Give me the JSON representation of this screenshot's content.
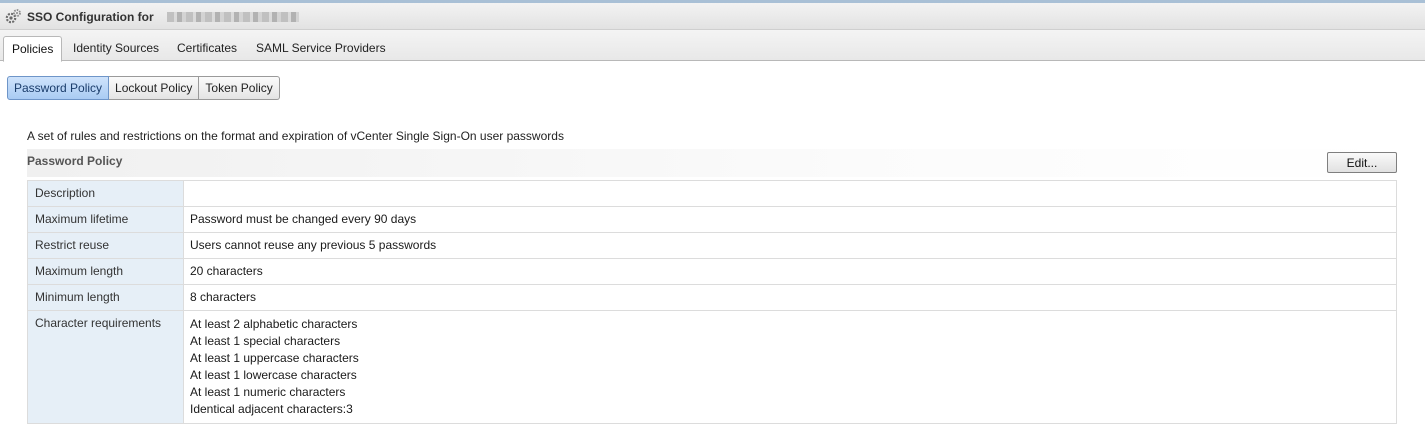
{
  "window": {
    "title": "SSO Configuration for",
    "gear_icon": "gear-icon"
  },
  "tabs": [
    {
      "label": "Policies",
      "active": true
    },
    {
      "label": "Identity Sources",
      "active": false
    },
    {
      "label": "Certificates",
      "active": false
    },
    {
      "label": "SAML Service Providers",
      "active": false
    }
  ],
  "subtabs": [
    {
      "label": "Password Policy",
      "active": true
    },
    {
      "label": "Lockout Policy",
      "active": false
    },
    {
      "label": "Token Policy",
      "active": false
    }
  ],
  "description_text": "A set of rules and restrictions on the format and expiration of vCenter Single Sign-On user passwords",
  "section": {
    "title": "Password Policy",
    "edit_label": "Edit..."
  },
  "properties": [
    {
      "key": "Description",
      "value": ""
    },
    {
      "key": "Maximum lifetime",
      "value": "Password must be changed every 90 days"
    },
    {
      "key": "Restrict reuse",
      "value": "Users cannot reuse any previous 5 passwords"
    },
    {
      "key": "Maximum length",
      "value": "20 characters"
    },
    {
      "key": "Minimum length",
      "value": "8 characters"
    }
  ],
  "character_requirements": {
    "key": "Character requirements",
    "lines": [
      "At least 2 alphabetic characters",
      "At least 1 special characters",
      "At least 1 uppercase characters",
      "At least 1 lowercase characters",
      "At least 1 numeric characters",
      "Identical adjacent characters:3"
    ]
  },
  "colors": {
    "active_subtab": "#a9cbf3",
    "key_column_bg": "#e6eff7"
  }
}
